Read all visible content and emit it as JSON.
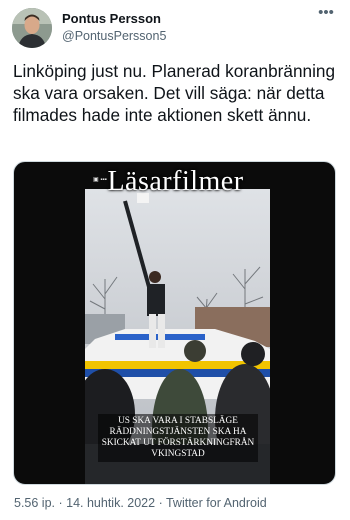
{
  "author": {
    "display_name": "Pontus Persson",
    "handle": "@PontusPersson5"
  },
  "more_menu_icon": "more-horizontal-icon",
  "tweet": {
    "text": "Linköping just nu. Planerad koranbränning ska vara orsaken. Det vill säga: när detta filmades hade inte aktionen skett ännu."
  },
  "media": {
    "watermark": "Läsarfilmer",
    "caption_lines": [
      "US SKA VARA I STABSLÄGE",
      "RÄDDNINGSTJÄNSTEN SKA HA",
      "SKICKAT UT FÖRSTÄRKNINGFRÅN",
      "VKINGSTAD"
    ]
  },
  "footer": {
    "time": "5.56 ip.",
    "separator": " · ",
    "date": "14. huhtik. 2022",
    "client": "Twitter for Android"
  }
}
